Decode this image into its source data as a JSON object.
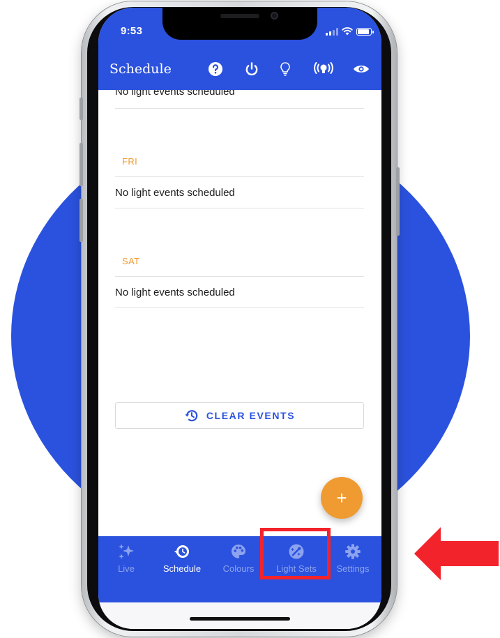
{
  "status_bar": {
    "time": "9:53"
  },
  "app_bar": {
    "title": "Schedule",
    "icons": [
      "help-icon",
      "power-icon",
      "bulb-icon",
      "broadcast-icon",
      "eye-icon"
    ]
  },
  "schedule": {
    "top_row_text": "No light events scheduled",
    "days": [
      {
        "label": "FRI",
        "message": "No light events scheduled"
      },
      {
        "label": "SAT",
        "message": "No light events scheduled"
      }
    ],
    "clear_button_label": "CLEAR EVENTS"
  },
  "fab": {
    "label": "+"
  },
  "bottom_nav": {
    "items": [
      {
        "label": "Live",
        "icon": "sparkles-icon",
        "active": false
      },
      {
        "label": "Schedule",
        "icon": "schedule-icon",
        "active": true
      },
      {
        "label": "Colours",
        "icon": "palette-icon",
        "active": false
      },
      {
        "label": "Light Sets",
        "icon": "light-sets-icon",
        "active": false,
        "highlighted": true
      },
      {
        "label": "Settings",
        "icon": "gear-icon",
        "active": false
      }
    ]
  },
  "colors": {
    "brand_blue": "#2b52de",
    "accent_orange": "#ef9b31",
    "highlight_red": "#f2232b"
  }
}
